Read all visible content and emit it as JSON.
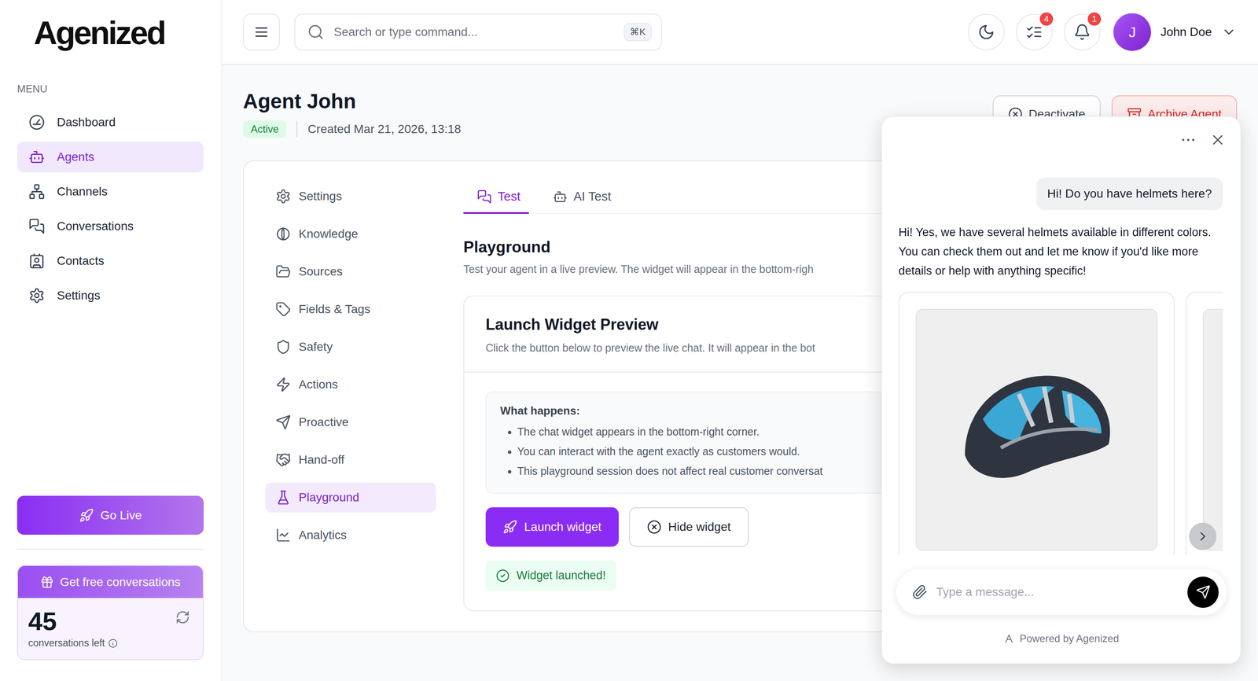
{
  "logo": {
    "text": "Agenized"
  },
  "sidebar": {
    "section_label": "MENU",
    "items": [
      {
        "label": "Dashboard",
        "selected": false
      },
      {
        "label": "Agents",
        "selected": true
      },
      {
        "label": "Channels",
        "selected": false
      },
      {
        "label": "Conversations",
        "selected": false
      },
      {
        "label": "Contacts",
        "selected": false
      },
      {
        "label": "Settings",
        "selected": false
      }
    ],
    "go_live": "Go Live",
    "promo": {
      "title": "Get free conversations",
      "count": "45",
      "caption": "conversations left"
    }
  },
  "header": {
    "search": {
      "placeholder": "Search or type command...",
      "shortcut": "⌘K"
    },
    "tasks_badge": "4",
    "notifications_badge": "1",
    "user": {
      "initial": "J",
      "name": "John Doe"
    }
  },
  "page": {
    "title": "Agent John",
    "status": "Active",
    "created": "Created Mar 21, 2026, 13:18",
    "actions": [
      {
        "label": "Deactivate",
        "kind": "neutral"
      },
      {
        "label": "Archive Agent",
        "kind": "danger"
      }
    ]
  },
  "subnav": [
    {
      "label": "Settings",
      "selected": false
    },
    {
      "label": "Knowledge",
      "selected": false
    },
    {
      "label": "Sources",
      "selected": false
    },
    {
      "label": "Fields & Tags",
      "selected": false
    },
    {
      "label": "Safety",
      "selected": false
    },
    {
      "label": "Actions",
      "selected": false
    },
    {
      "label": "Proactive",
      "selected": false
    },
    {
      "label": "Hand-off",
      "selected": false
    },
    {
      "label": "Playground",
      "selected": true
    },
    {
      "label": "Analytics",
      "selected": false
    }
  ],
  "tabs": [
    {
      "label": "Test",
      "selected": true
    },
    {
      "label": "AI Test",
      "selected": false
    }
  ],
  "playground": {
    "title": "Playground",
    "description": "Test your agent in a live preview. The widget will appear in the bottom-righ"
  },
  "preview": {
    "title": "Launch Widget Preview",
    "description": "Click the button below to preview the live chat. It will appear in the bot",
    "info_title": "What happens:",
    "bullets": [
      "The chat widget appears in the bottom-right corner.",
      "You can interact with the agent exactly as customers would.",
      "This playground session does not affect real customer conversat"
    ],
    "buttons": [
      {
        "label": "Launch widget",
        "kind": "primary"
      },
      {
        "label": "Hide widget",
        "kind": "secondary"
      }
    ],
    "status": "Widget launched!"
  },
  "widget": {
    "messages": [
      {
        "role": "user",
        "text": "Hi! Do you have helmets here?"
      },
      {
        "role": "agent",
        "text": "Hi! Yes, we have several helmets available in different colors. You can check them out and let me know if you'd like more details or help with anything specific!"
      }
    ],
    "products": [
      {
        "has_image": true
      },
      {
        "has_image": true
      }
    ],
    "input_placeholder": "Type a message...",
    "footer": "Powered by Agenized"
  }
}
